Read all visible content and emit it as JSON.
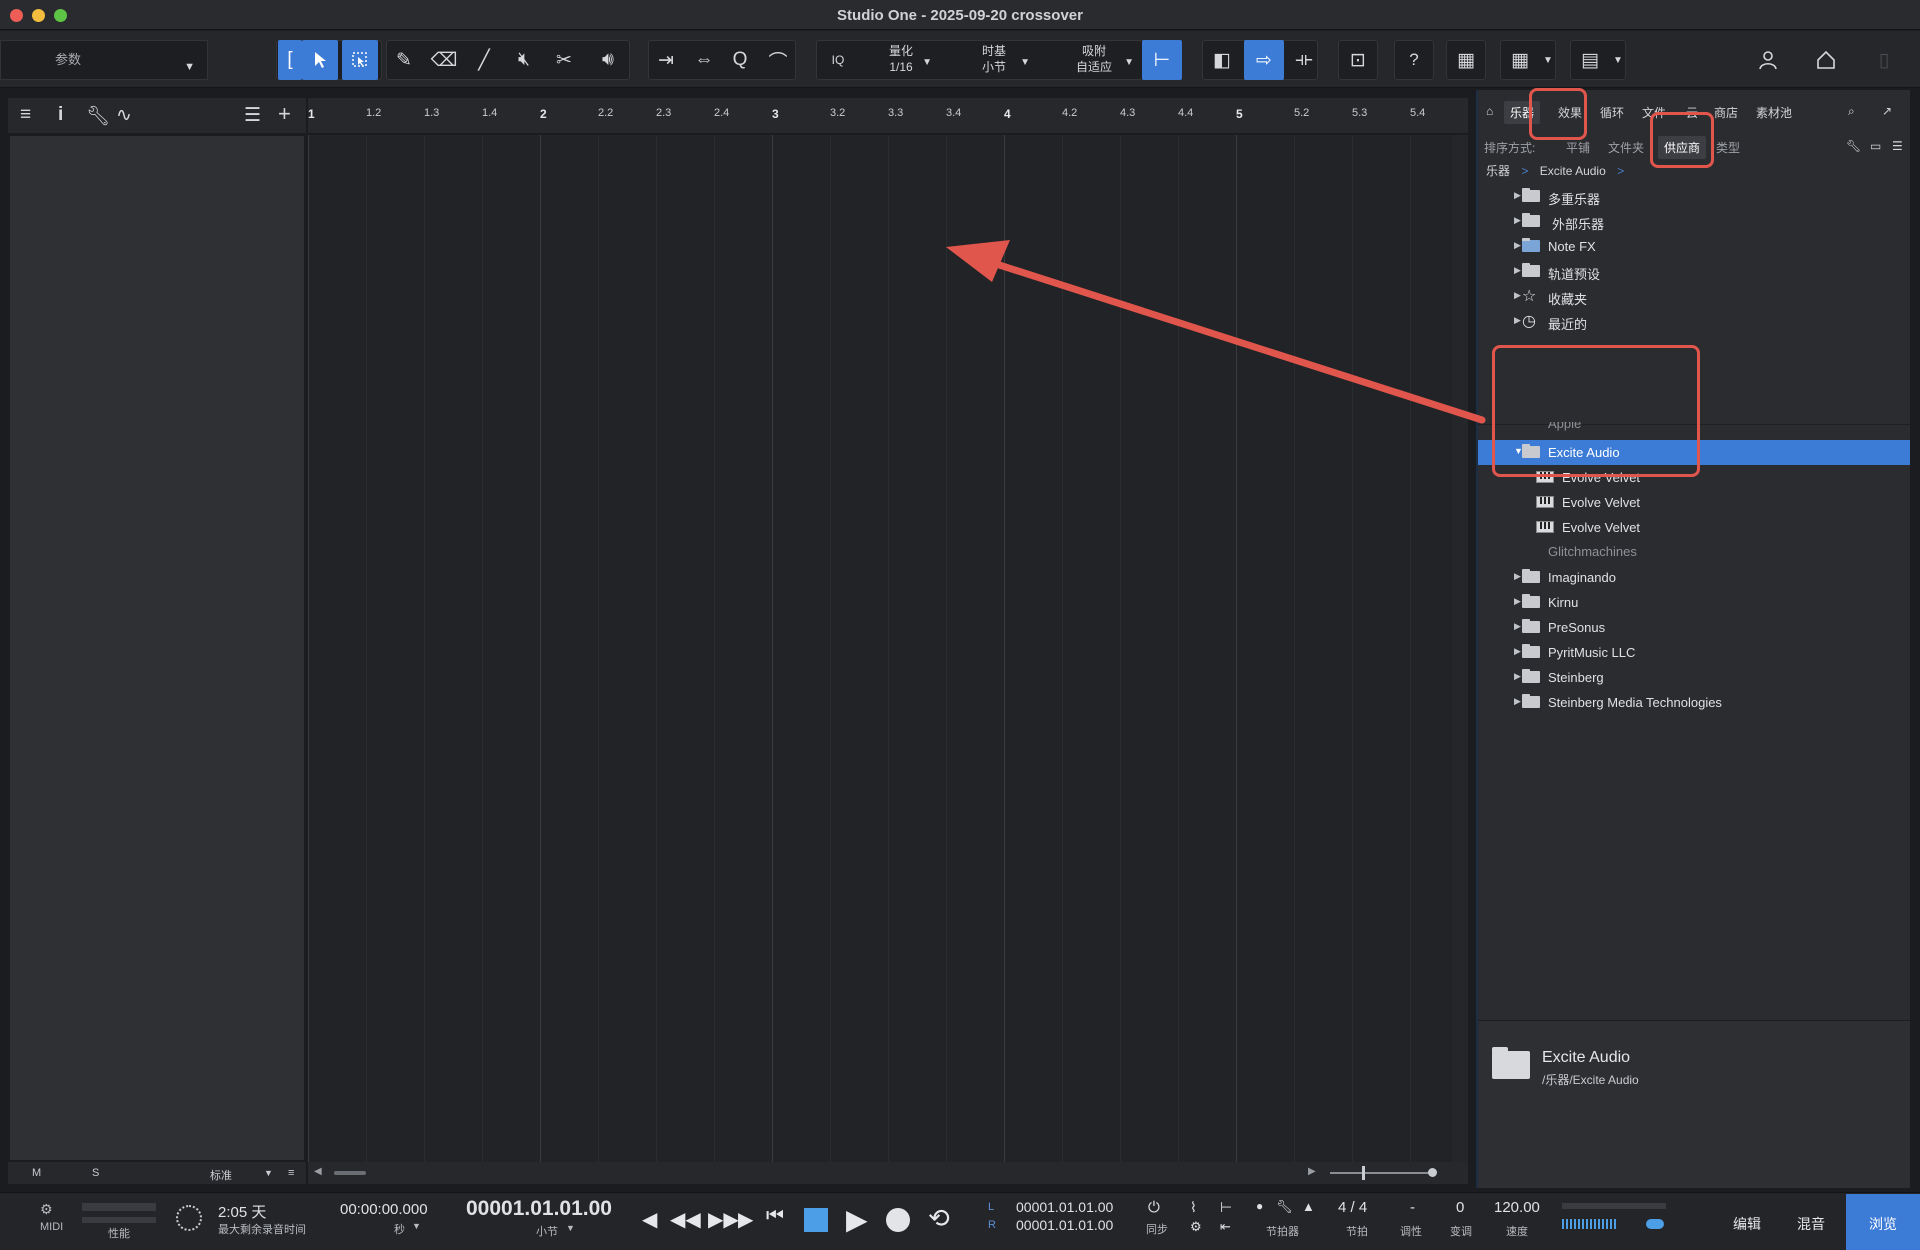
{
  "window": {
    "title": "Studio One - 2025-09-20 crossover"
  },
  "toolbar": {
    "param_label": "参数",
    "iq_label": "IQ",
    "quantize": {
      "label": "量化",
      "value": "1/16"
    },
    "timebase": {
      "label": "时基",
      "value": "小节"
    },
    "snap": {
      "label": "吸附",
      "value": "自适应"
    },
    "help_label": "?"
  },
  "ruler": {
    "labels": [
      "1",
      "1.2",
      "1.3",
      "1.4",
      "2",
      "2.2",
      "2.3",
      "2.4",
      "3",
      "3.2",
      "3.3",
      "3.4",
      "4",
      "4.2",
      "4.3",
      "4.4",
      "5",
      "5.2",
      "5.3",
      "5.4"
    ]
  },
  "inspector": {
    "bottom": {
      "m": "M",
      "s": "S",
      "mode": "标准"
    }
  },
  "browser": {
    "tabs": [
      "乐器",
      "效果",
      "循环",
      "文件",
      "云",
      "商店",
      "素材池"
    ],
    "selected_tab": "乐器",
    "sort_label": "排序方式:",
    "sort_options": [
      "平铺",
      "文件夹",
      "供应商",
      "类型"
    ],
    "selected_sort": "供应商",
    "breadcrumb": [
      "乐器",
      "Excite Audio"
    ],
    "tree_top": [
      {
        "label": "多重乐器",
        "icon": "multi-instrument-icon"
      },
      {
        "label": "外部乐器",
        "icon": "external-instrument-icon"
      },
      {
        "label": "Note FX",
        "icon": "folder-icon"
      },
      {
        "label": "轨道预设",
        "icon": "track-preset-icon"
      },
      {
        "label": "收藏夹",
        "icon": "star-icon"
      },
      {
        "label": "最近的",
        "icon": "clock-icon"
      }
    ],
    "vendors_partial_top": "Apple",
    "selected_vendor": "Excite Audio",
    "vendor_children": [
      "Evolve Velvet",
      "Evolve Velvet",
      "Evolve Velvet"
    ],
    "vendors_partial_after": "Glitchmachines",
    "vendors": [
      "Imaginando",
      "Kirnu",
      "PreSonus",
      "PyritMusic LLC",
      "Steinberg",
      "Steinberg Media Technologies"
    ],
    "info": {
      "title": "Excite Audio",
      "path": "/乐器/Excite Audio"
    }
  },
  "transport": {
    "midi_label": "MIDI",
    "perf_label": "性能",
    "record_time": "2:05 天",
    "record_time_label": "最大剩余录音时间",
    "seconds_time": "00:00:00.000",
    "seconds_label": "秒",
    "bars_time": "00001.01.01.00",
    "bars_label": "小节",
    "loop_l": "00001.01.01.00",
    "loop_r": "00001.01.01.00",
    "l_label": "L",
    "r_label": "R",
    "sync_label": "同步",
    "metronome_label": "节拍器",
    "signature": "4 / 4",
    "signature_label": "节拍",
    "key_value": "-",
    "key_label": "调性",
    "transpose_value": "0",
    "transpose_label": "变调",
    "tempo_value": "120.00",
    "tempo_label": "速度"
  },
  "bottom_tabs": [
    "编辑",
    "混音",
    "浏览"
  ],
  "active_bottom_tab": "浏览",
  "colors": {
    "accent": "#3c7bd6",
    "annotation": "#e0564c"
  }
}
